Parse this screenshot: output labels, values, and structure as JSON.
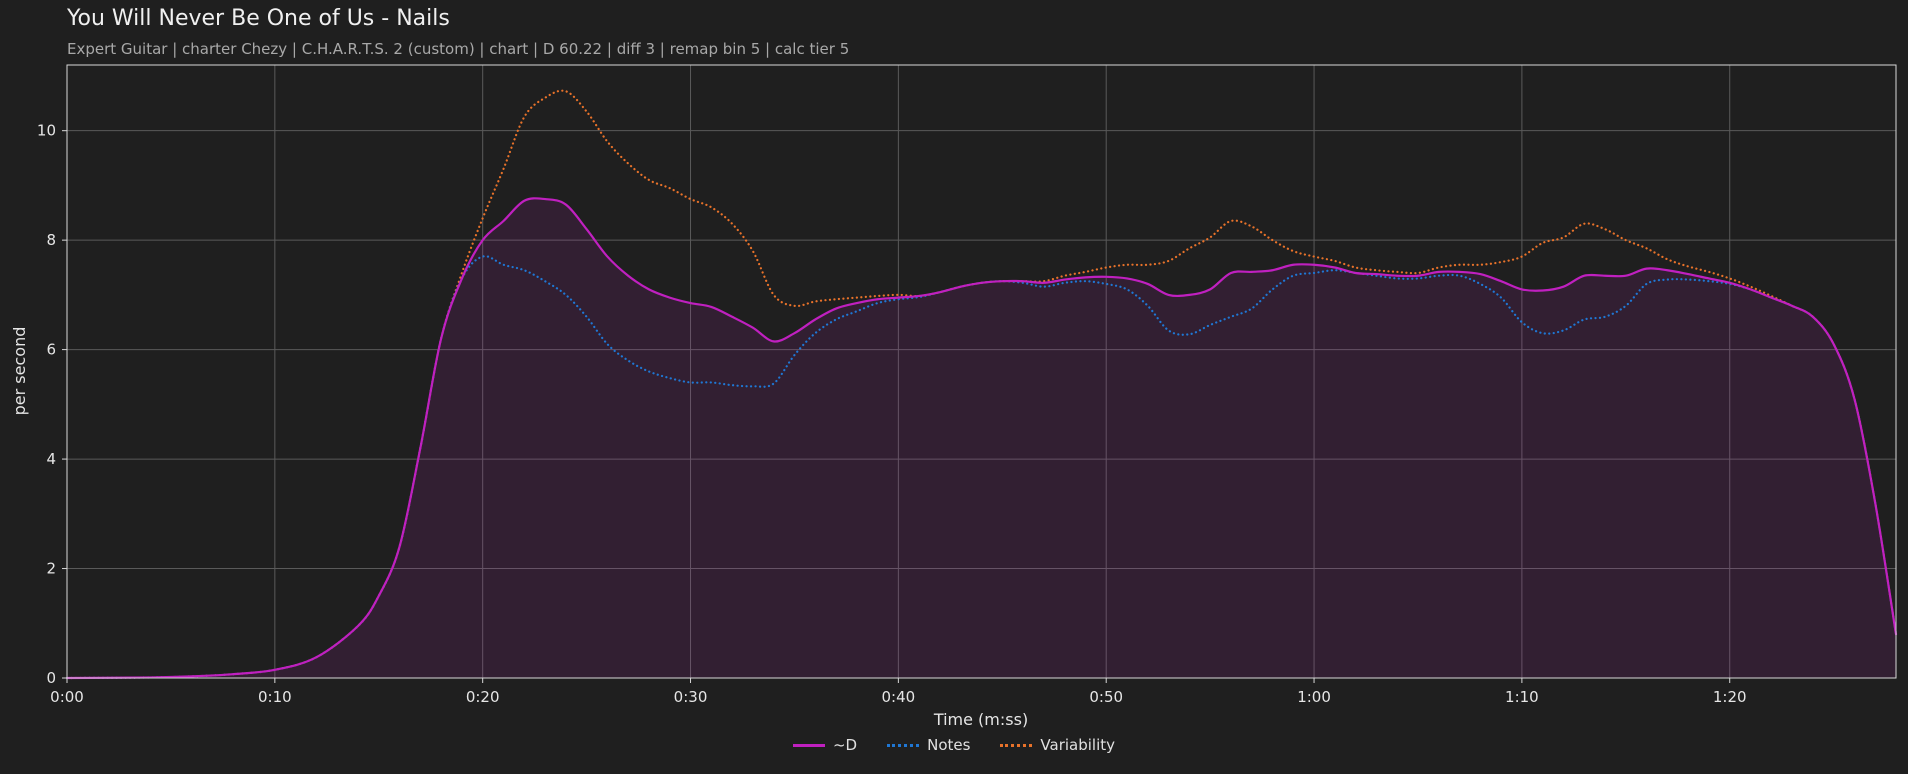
{
  "header": {
    "title": "You Will Never Be One of Us - Nails",
    "subtitle": "Expert Guitar  |  charter Chezy  |  C.H.A.R.T.S. 2 (custom)  |  chart  |  D 60.22  |  diff 3  |  remap bin 5  |  calc tier 5"
  },
  "chart_data": {
    "type": "line",
    "title": "You Will Never Be One of Us - Nails",
    "xlabel": "Time (m:ss)",
    "ylabel": "per second",
    "xlim": [
      0,
      88
    ],
    "ylim": [
      0,
      11.2
    ],
    "xticks": [
      0,
      10,
      20,
      30,
      40,
      50,
      60,
      70,
      80
    ],
    "xtick_labels": [
      "0:00",
      "0:10",
      "0:20",
      "0:30",
      "0:40",
      "0:50",
      "1:00",
      "1:10",
      "1:20"
    ],
    "yticks": [
      0,
      2,
      4,
      6,
      8,
      10
    ],
    "ytick_labels": [
      "0",
      "2",
      "4",
      "6",
      "8",
      "10"
    ],
    "grid": true,
    "legend_position": "bottom-center",
    "series": [
      {
        "name": "~D",
        "color": "#c020c0",
        "style": "solid",
        "filled": true,
        "points": [
          [
            0,
            0
          ],
          [
            4,
            0.01
          ],
          [
            6,
            0.03
          ],
          [
            8,
            0.07
          ],
          [
            10,
            0.15
          ],
          [
            12,
            0.38
          ],
          [
            14,
            0.95
          ],
          [
            15,
            1.5
          ],
          [
            16,
            2.4
          ],
          [
            17,
            4.2
          ],
          [
            18,
            6.2
          ],
          [
            19,
            7.3
          ],
          [
            20,
            8.0
          ],
          [
            21,
            8.35
          ],
          [
            22,
            8.72
          ],
          [
            23,
            8.75
          ],
          [
            24,
            8.65
          ],
          [
            25,
            8.2
          ],
          [
            26,
            7.7
          ],
          [
            27,
            7.35
          ],
          [
            28,
            7.1
          ],
          [
            29,
            6.95
          ],
          [
            30,
            6.85
          ],
          [
            31,
            6.78
          ],
          [
            32,
            6.6
          ],
          [
            33,
            6.4
          ],
          [
            34,
            6.15
          ],
          [
            35,
            6.3
          ],
          [
            36,
            6.55
          ],
          [
            37,
            6.75
          ],
          [
            38,
            6.85
          ],
          [
            39,
            6.92
          ],
          [
            40,
            6.95
          ],
          [
            41,
            6.98
          ],
          [
            42,
            7.05
          ],
          [
            43,
            7.15
          ],
          [
            44,
            7.22
          ],
          [
            45,
            7.25
          ],
          [
            46,
            7.25
          ],
          [
            47,
            7.22
          ],
          [
            48,
            7.28
          ],
          [
            49,
            7.32
          ],
          [
            50,
            7.33
          ],
          [
            51,
            7.3
          ],
          [
            52,
            7.2
          ],
          [
            53,
            7.0
          ],
          [
            54,
            7.0
          ],
          [
            55,
            7.1
          ],
          [
            56,
            7.4
          ],
          [
            57,
            7.42
          ],
          [
            58,
            7.45
          ],
          [
            59,
            7.55
          ],
          [
            60,
            7.55
          ],
          [
            61,
            7.5
          ],
          [
            62,
            7.4
          ],
          [
            63,
            7.38
          ],
          [
            64,
            7.35
          ],
          [
            65,
            7.35
          ],
          [
            66,
            7.42
          ],
          [
            67,
            7.42
          ],
          [
            68,
            7.38
          ],
          [
            69,
            7.25
          ],
          [
            70,
            7.1
          ],
          [
            71,
            7.08
          ],
          [
            72,
            7.15
          ],
          [
            73,
            7.35
          ],
          [
            74,
            7.35
          ],
          [
            75,
            7.35
          ],
          [
            76,
            7.48
          ],
          [
            77,
            7.45
          ],
          [
            78,
            7.38
          ],
          [
            79,
            7.3
          ],
          [
            80,
            7.22
          ],
          [
            81,
            7.1
          ],
          [
            82,
            6.95
          ],
          [
            83,
            6.8
          ],
          [
            84,
            6.6
          ],
          [
            85,
            6.1
          ],
          [
            86,
            5.1
          ],
          [
            87,
            3.2
          ],
          [
            88,
            0.8
          ]
        ]
      },
      {
        "name": "Notes",
        "color": "#1f77d4",
        "style": "dotted",
        "filled": false,
        "points": [
          [
            0,
            0
          ],
          [
            4,
            0.01
          ],
          [
            6,
            0.03
          ],
          [
            8,
            0.07
          ],
          [
            10,
            0.15
          ],
          [
            12,
            0.38
          ],
          [
            14,
            0.95
          ],
          [
            15,
            1.5
          ],
          [
            16,
            2.4
          ],
          [
            17,
            4.2
          ],
          [
            18,
            6.2
          ],
          [
            19,
            7.3
          ],
          [
            20,
            7.7
          ],
          [
            21,
            7.55
          ],
          [
            22,
            7.45
          ],
          [
            23,
            7.25
          ],
          [
            24,
            7.0
          ],
          [
            25,
            6.6
          ],
          [
            26,
            6.1
          ],
          [
            27,
            5.8
          ],
          [
            28,
            5.6
          ],
          [
            29,
            5.48
          ],
          [
            30,
            5.4
          ],
          [
            31,
            5.4
          ],
          [
            32,
            5.35
          ],
          [
            33,
            5.33
          ],
          [
            34,
            5.38
          ],
          [
            35,
            5.9
          ],
          [
            36,
            6.3
          ],
          [
            37,
            6.55
          ],
          [
            38,
            6.7
          ],
          [
            39,
            6.85
          ],
          [
            40,
            6.92
          ],
          [
            41,
            6.96
          ],
          [
            42,
            7.05
          ],
          [
            43,
            7.15
          ],
          [
            44,
            7.22
          ],
          [
            45,
            7.25
          ],
          [
            46,
            7.22
          ],
          [
            47,
            7.15
          ],
          [
            48,
            7.22
          ],
          [
            49,
            7.25
          ],
          [
            50,
            7.2
          ],
          [
            51,
            7.1
          ],
          [
            52,
            6.8
          ],
          [
            53,
            6.35
          ],
          [
            54,
            6.28
          ],
          [
            55,
            6.45
          ],
          [
            56,
            6.6
          ],
          [
            57,
            6.75
          ],
          [
            58,
            7.1
          ],
          [
            59,
            7.35
          ],
          [
            60,
            7.4
          ],
          [
            61,
            7.45
          ],
          [
            62,
            7.4
          ],
          [
            63,
            7.35
          ],
          [
            64,
            7.3
          ],
          [
            65,
            7.3
          ],
          [
            66,
            7.35
          ],
          [
            67,
            7.35
          ],
          [
            68,
            7.2
          ],
          [
            69,
            6.95
          ],
          [
            70,
            6.5
          ],
          [
            71,
            6.3
          ],
          [
            72,
            6.35
          ],
          [
            73,
            6.55
          ],
          [
            74,
            6.6
          ],
          [
            75,
            6.8
          ],
          [
            76,
            7.2
          ],
          [
            77,
            7.28
          ],
          [
            78,
            7.28
          ],
          [
            79,
            7.25
          ],
          [
            80,
            7.2
          ],
          [
            81,
            7.1
          ],
          [
            82,
            6.95
          ],
          [
            83,
            6.8
          ],
          [
            84,
            6.6
          ],
          [
            85,
            6.1
          ],
          [
            86,
            5.1
          ],
          [
            87,
            3.2
          ],
          [
            88,
            0.8
          ]
        ]
      },
      {
        "name": "Variability",
        "color": "#e8722a",
        "style": "dotted",
        "filled": false,
        "points": [
          [
            0,
            0
          ],
          [
            4,
            0.01
          ],
          [
            6,
            0.03
          ],
          [
            8,
            0.07
          ],
          [
            10,
            0.15
          ],
          [
            12,
            0.38
          ],
          [
            14,
            0.95
          ],
          [
            15,
            1.5
          ],
          [
            16,
            2.4
          ],
          [
            17,
            4.2
          ],
          [
            18,
            6.2
          ],
          [
            19,
            7.4
          ],
          [
            20,
            8.4
          ],
          [
            21,
            9.3
          ],
          [
            22,
            10.25
          ],
          [
            23,
            10.6
          ],
          [
            24,
            10.72
          ],
          [
            25,
            10.35
          ],
          [
            26,
            9.8
          ],
          [
            27,
            9.4
          ],
          [
            28,
            9.1
          ],
          [
            29,
            8.95
          ],
          [
            30,
            8.75
          ],
          [
            31,
            8.6
          ],
          [
            32,
            8.3
          ],
          [
            33,
            7.8
          ],
          [
            34,
            7.0
          ],
          [
            35,
            6.8
          ],
          [
            36,
            6.88
          ],
          [
            37,
            6.92
          ],
          [
            38,
            6.95
          ],
          [
            39,
            6.98
          ],
          [
            40,
            7.0
          ],
          [
            41,
            6.98
          ],
          [
            42,
            7.05
          ],
          [
            43,
            7.15
          ],
          [
            44,
            7.22
          ],
          [
            45,
            7.25
          ],
          [
            46,
            7.25
          ],
          [
            47,
            7.25
          ],
          [
            48,
            7.35
          ],
          [
            49,
            7.42
          ],
          [
            50,
            7.5
          ],
          [
            51,
            7.55
          ],
          [
            52,
            7.55
          ],
          [
            53,
            7.62
          ],
          [
            54,
            7.85
          ],
          [
            55,
            8.05
          ],
          [
            56,
            8.35
          ],
          [
            57,
            8.25
          ],
          [
            58,
            8.0
          ],
          [
            59,
            7.8
          ],
          [
            60,
            7.7
          ],
          [
            61,
            7.62
          ],
          [
            62,
            7.5
          ],
          [
            63,
            7.45
          ],
          [
            64,
            7.42
          ],
          [
            65,
            7.4
          ],
          [
            66,
            7.5
          ],
          [
            67,
            7.55
          ],
          [
            68,
            7.55
          ],
          [
            69,
            7.6
          ],
          [
            70,
            7.7
          ],
          [
            71,
            7.95
          ],
          [
            72,
            8.05
          ],
          [
            73,
            8.3
          ],
          [
            74,
            8.2
          ],
          [
            75,
            8.0
          ],
          [
            76,
            7.85
          ],
          [
            77,
            7.65
          ],
          [
            78,
            7.52
          ],
          [
            79,
            7.42
          ],
          [
            80,
            7.3
          ],
          [
            81,
            7.15
          ],
          [
            82,
            6.98
          ],
          [
            83,
            6.8
          ],
          [
            84,
            6.6
          ],
          [
            85,
            6.1
          ],
          [
            86,
            5.1
          ],
          [
            87,
            3.2
          ],
          [
            88,
            0.8
          ]
        ]
      }
    ]
  }
}
